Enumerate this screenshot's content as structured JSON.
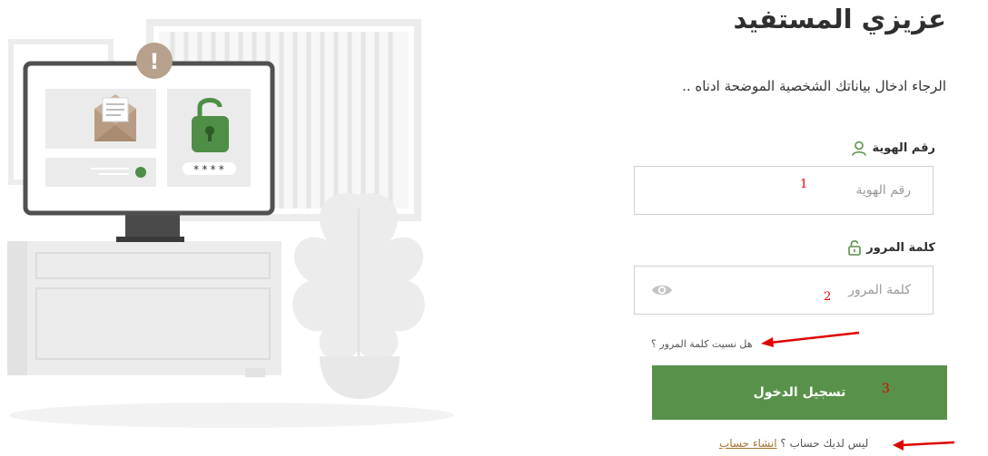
{
  "page": {
    "title": "عزيزي المستفيد",
    "subtitle": "الرجاء ادخال بياناتك الشخصية الموضحة ادناه .."
  },
  "id_field": {
    "label": "رقم الهوية",
    "placeholder": "رقم الهوية",
    "value": "",
    "icon": "user-icon"
  },
  "password_field": {
    "label": "كلمة المرور",
    "placeholder": "كلمة المرور",
    "value": "",
    "icon": "unlock-icon",
    "toggle_icon": "eye-icon"
  },
  "forgot_password": "هل نسيت كلمة المرور ؟",
  "login_button": "تسجيل الدخول",
  "register": {
    "question": "ليس لديك حساب ؟",
    "link": "انشاء حساب"
  },
  "annotations": {
    "step1": "1",
    "step2": "2",
    "step3": "3"
  },
  "illustration": {
    "password_mask": "****",
    "alert_symbol": "!"
  },
  "colors": {
    "accent_green": "#58924a",
    "annotation_red": "#e00000",
    "link_brown": "#a3722a"
  }
}
